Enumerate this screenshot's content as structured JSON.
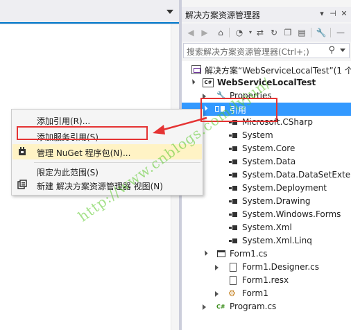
{
  "solution_explorer": {
    "title": "解决方案资源管理器",
    "search_placeholder": "搜索解决方案资源管理器(Ctrl+;)",
    "tree": [
      {
        "label": "解决方案“WebServiceLocalTest”(1 个",
        "kind": "solution"
      },
      {
        "label": "WebServiceLocalTest",
        "kind": "csproj",
        "icon_text": "C#"
      },
      {
        "label": "Properties",
        "kind": "properties"
      },
      {
        "label": "引用",
        "kind": "references",
        "selected": true
      },
      {
        "label": "Microsoft.CSharp",
        "kind": "assembly"
      },
      {
        "label": "System",
        "kind": "assembly"
      },
      {
        "label": "System.Core",
        "kind": "assembly"
      },
      {
        "label": "System.Data",
        "kind": "assembly"
      },
      {
        "label": "System.Data.DataSetExtensi",
        "kind": "assembly"
      },
      {
        "label": "System.Deployment",
        "kind": "assembly"
      },
      {
        "label": "System.Drawing",
        "kind": "assembly"
      },
      {
        "label": "System.Windows.Forms",
        "kind": "assembly"
      },
      {
        "label": "System.Xml",
        "kind": "assembly"
      },
      {
        "label": "System.Xml.Linq",
        "kind": "assembly"
      },
      {
        "label": "Form1.cs",
        "kind": "form"
      },
      {
        "label": "Form1.Designer.cs",
        "kind": "cs"
      },
      {
        "label": "Form1.resx",
        "kind": "file"
      },
      {
        "label": "Form1",
        "kind": "class"
      },
      {
        "label": "Program.cs",
        "kind": "cs"
      }
    ]
  },
  "context_menu": {
    "items": [
      {
        "label": "添加引用(R)...",
        "icon": ""
      },
      {
        "label": "添加服务引用(S)...",
        "icon": ""
      },
      {
        "label": "管理 NuGet 程序包(N)...",
        "icon": "nuget-icon"
      },
      {
        "label": "限定为此范围(S)",
        "icon": ""
      },
      {
        "label": "新建 解决方案资源管理器 视图(N)",
        "icon": "new-view-icon"
      }
    ]
  },
  "watermark": "http://www.cnblogs.com/lyjun/",
  "colors": {
    "selection": "#3399ff",
    "highlight_box": "#e53333",
    "menu_hover": "#fff3c5"
  }
}
